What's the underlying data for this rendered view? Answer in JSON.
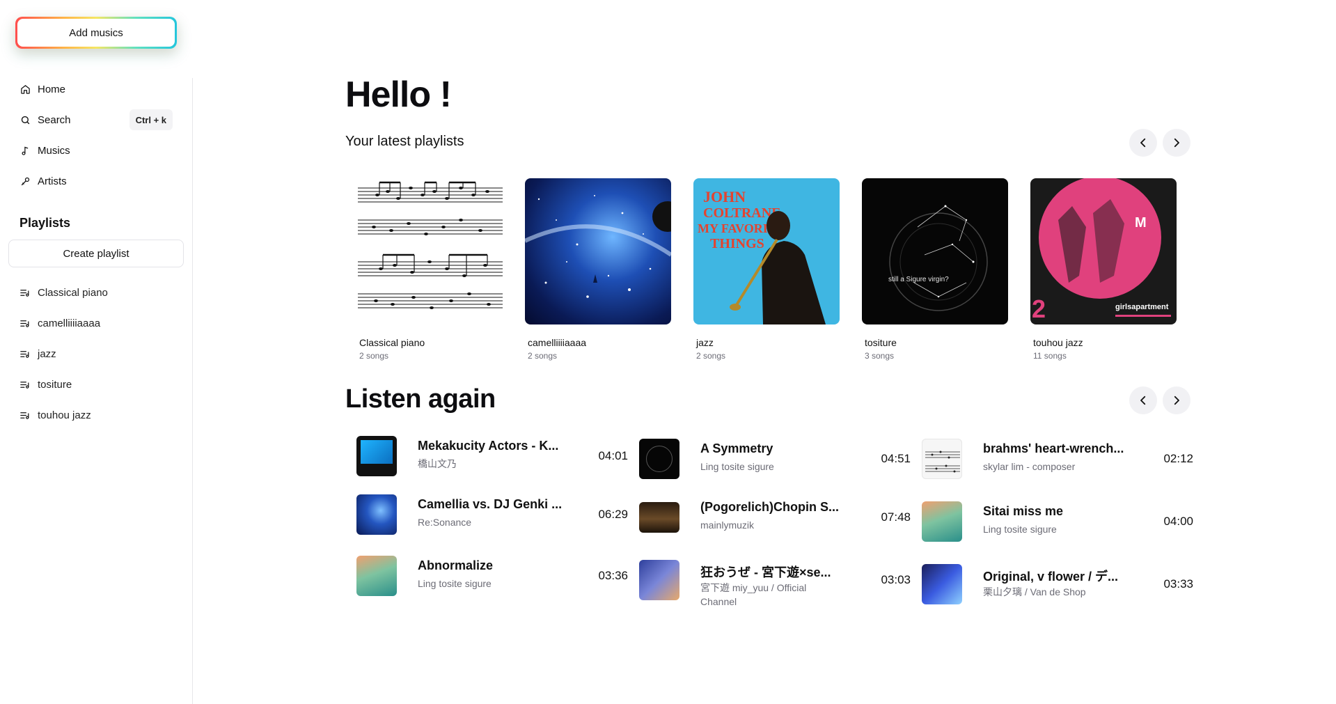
{
  "sidebar": {
    "add_button": "Add musics",
    "nav": [
      {
        "label": "Home",
        "icon": "home-icon"
      },
      {
        "label": "Search",
        "icon": "search-icon",
        "shortcut": "Ctrl + k"
      },
      {
        "label": "Musics",
        "icon": "music-note-icon"
      },
      {
        "label": "Artists",
        "icon": "microphone-icon"
      }
    ],
    "playlists_title": "Playlists",
    "create_button": "Create playlist",
    "playlists": [
      {
        "label": "Classical piano"
      },
      {
        "label": "camelliiiiaaaa"
      },
      {
        "label": "jazz"
      },
      {
        "label": "tositure"
      },
      {
        "label": "touhou jazz"
      }
    ]
  },
  "main": {
    "greeting": "Hello !",
    "latest_title": "Your latest playlists",
    "playlists": [
      {
        "name": "Classical piano",
        "count": "2 songs"
      },
      {
        "name": "camelliiiiaaaa",
        "count": "2 songs"
      },
      {
        "name": "jazz",
        "count": "2 songs",
        "cover_text": "JOHN COLTRANE MY FAVORITE THINGS"
      },
      {
        "name": "tositure",
        "count": "3 songs",
        "cover_text": "still a Sigure virgin?"
      },
      {
        "name": "touhou jazz",
        "count": "11 songs",
        "cover_text": "girlsapartment"
      }
    ],
    "listen_again_title": "Listen again",
    "songs": [
      {
        "title": "Mekakucity Actors - K...",
        "artist": "橋山文乃",
        "duration": "04:01"
      },
      {
        "title": "Camellia vs. DJ Genki ...",
        "artist": "Re:Sonance",
        "duration": "06:29"
      },
      {
        "title": "Abnormalize",
        "artist": "Ling tosite sigure",
        "duration": "03:36"
      },
      {
        "title": "A Symmetry",
        "artist": "Ling tosite sigure",
        "duration": "04:51"
      },
      {
        "title": "(Pogorelich)Chopin S...",
        "artist": "mainlymuzik",
        "duration": "07:48"
      },
      {
        "title": "狂おうぜ - 宮下遊×se...",
        "artist": "宮下遊 miy_yuu / Official Channel",
        "duration": "03:03"
      },
      {
        "title": "brahms' heart-wrench...",
        "artist": "skylar lim - composer",
        "duration": "02:12"
      },
      {
        "title": "Sitai miss me",
        "artist": "Ling tosite sigure",
        "duration": "04:00"
      },
      {
        "title": "Original, v flower / デ...",
        "artist": "栗山夕璃 / Van de Shop",
        "duration": "03:33"
      }
    ]
  }
}
